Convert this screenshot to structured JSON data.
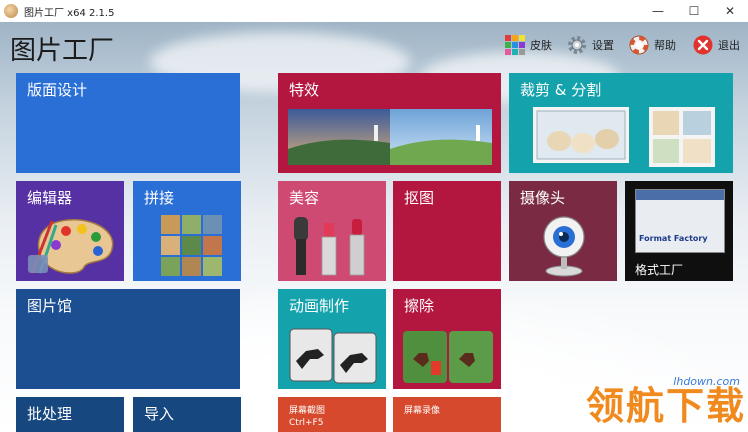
{
  "window": {
    "title": "图片工厂 x64 2.1.5",
    "minimize": "—",
    "maximize": "☐",
    "close": "✕"
  },
  "app": {
    "title": "图片工厂"
  },
  "toolbar": {
    "skin": "皮肤",
    "settings": "设置",
    "help": "帮助",
    "exit": "退出"
  },
  "tiles": {
    "layout_design": "版面设计",
    "effects": "特效",
    "crop_split": "裁剪 & 分割",
    "editor": "编辑器",
    "collage": "拼接",
    "beauty": "美容",
    "cutout": "抠图",
    "camera": "摄像头",
    "format_factory": "格式工厂",
    "format_factory_logo": "Format Factory",
    "gallery": "图片馆",
    "animation": "动画制作",
    "erase": "擦除",
    "batch": "批处理",
    "import": "导入",
    "screenshot": "屏幕截图",
    "screenshot_hotkey": "Ctrl+F5",
    "screen_record": "屏幕录像"
  },
  "watermark": {
    "text": "领航下载",
    "url": "lhdown.com"
  },
  "colors": {
    "blue": "#2a6fd6",
    "dark_blue": "#1c4f92",
    "navy": "#16477f",
    "crimson": "#b3173f",
    "pink": "#cf4a72",
    "teal": "#14a3ad",
    "maroon": "#7a2b43",
    "purple": "#5631a3",
    "orange_red": "#d6492c"
  }
}
